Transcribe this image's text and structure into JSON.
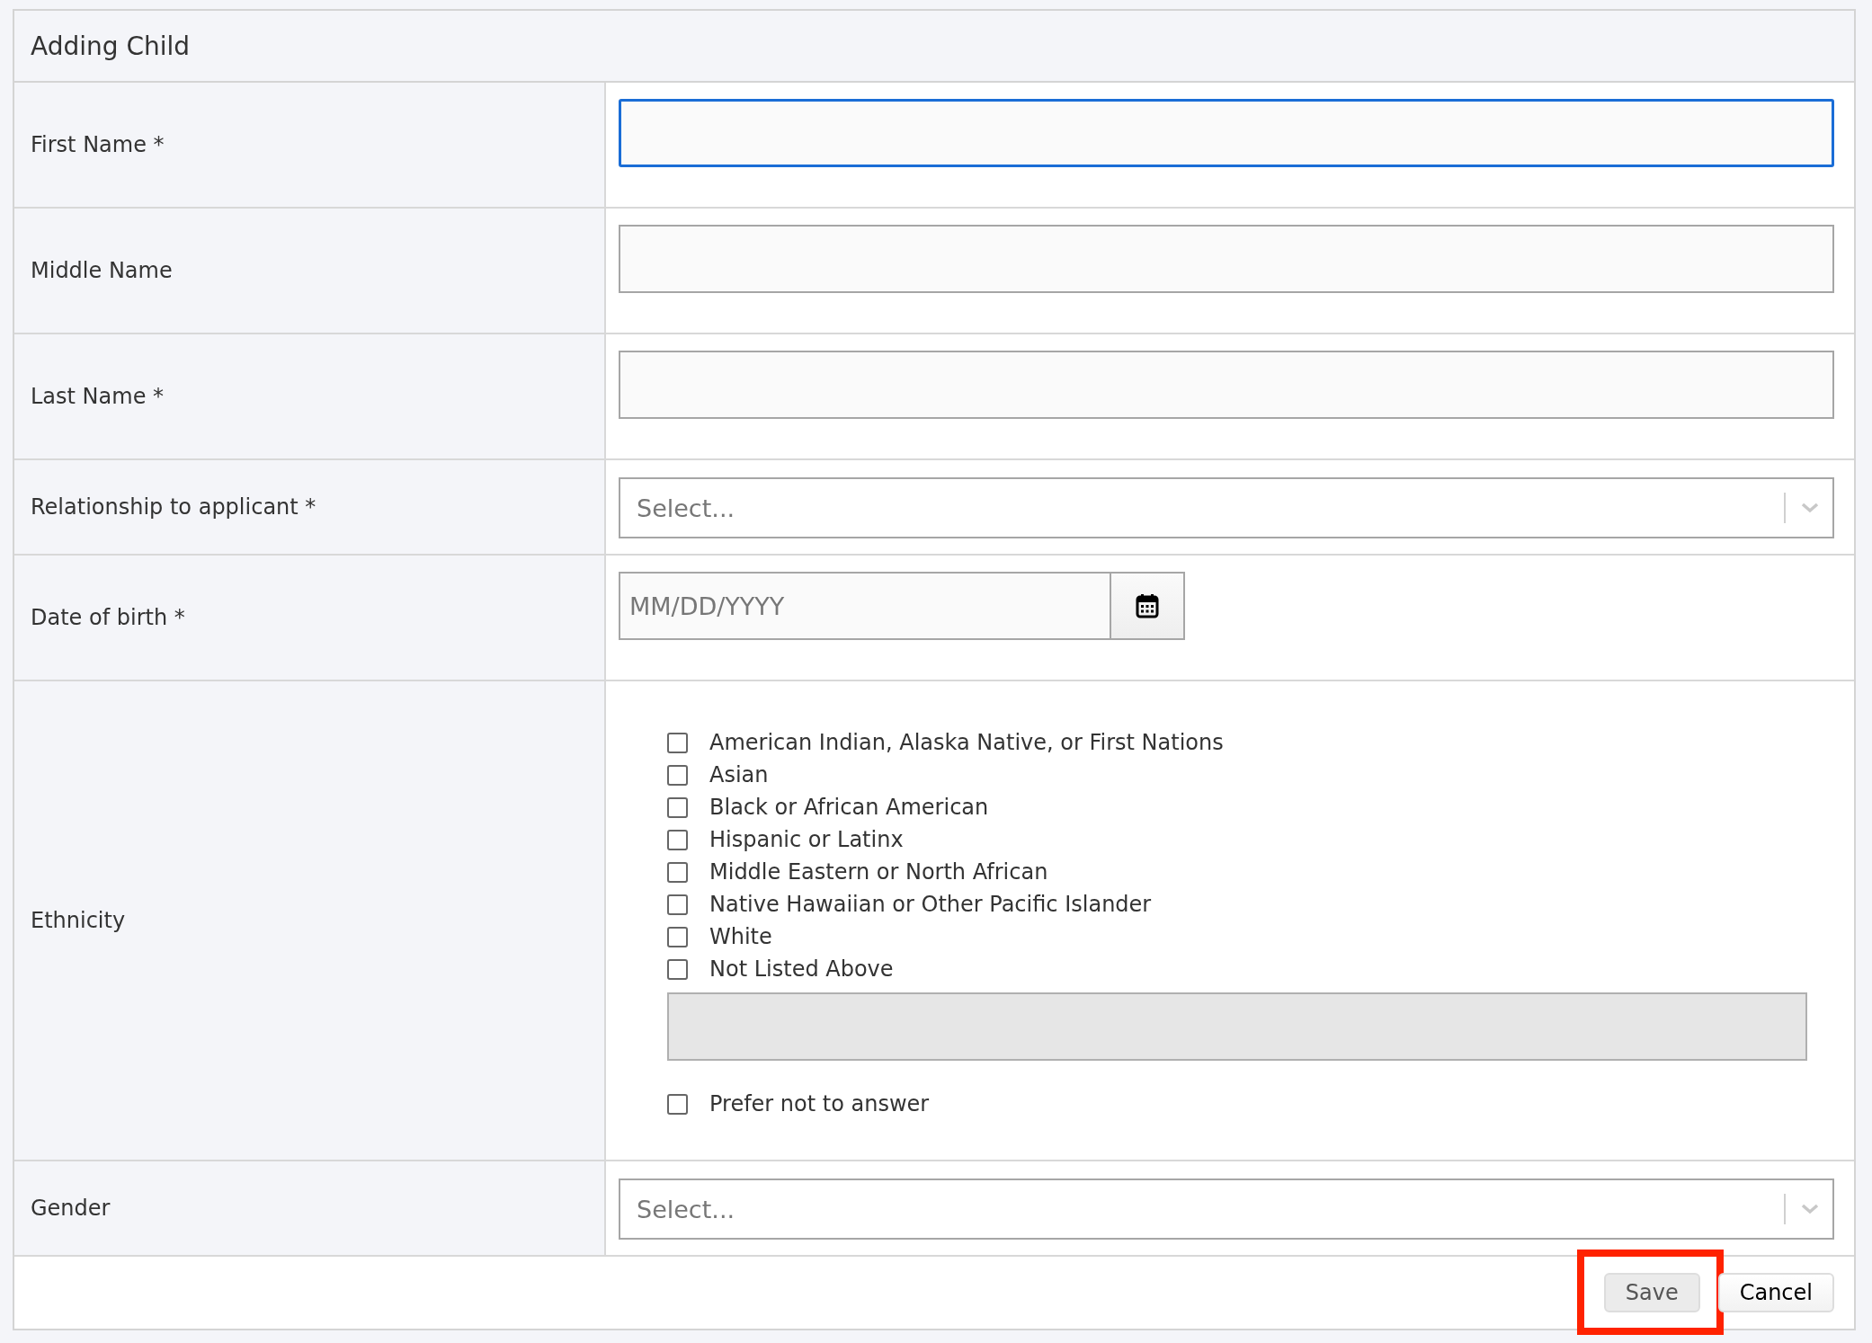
{
  "title": "Adding Child",
  "fields": [
    {
      "kind": "text",
      "label": "First Name *",
      "focused": true
    },
    {
      "kind": "text",
      "label": "Middle Name",
      "focused": false
    },
    {
      "kind": "text",
      "label": "Last Name *",
      "focused": false
    },
    {
      "kind": "select",
      "label": "Relationship to applicant *",
      "placeholder": "Select..."
    },
    {
      "kind": "date",
      "label": "Date of birth *",
      "placeholder": "MM/DD/YYYY"
    },
    {
      "kind": "checkboxes",
      "label": "Ethnicity",
      "options": [
        {
          "label": "American Indian, Alaska Native, or First Nations",
          "checked": false
        },
        {
          "label": "Asian",
          "checked": false
        },
        {
          "label": "Black or African American",
          "checked": false
        },
        {
          "label": "Hispanic or Latinx",
          "checked": false
        },
        {
          "label": "Middle Eastern or North African",
          "checked": false
        },
        {
          "label": "Native Hawaiian or Other Pacific Islander",
          "checked": false
        },
        {
          "label": "White",
          "checked": false
        },
        {
          "label": "Not Listed Above",
          "checked": false
        }
      ],
      "other_field": {
        "disabled": true
      },
      "opt_out": {
        "label": "Prefer not to answer",
        "checked": false
      }
    },
    {
      "kind": "select",
      "label": "Gender",
      "placeholder": "Select..."
    }
  ],
  "buttons": [
    {
      "label": "Save",
      "highlighted": true
    },
    {
      "label": "Cancel",
      "highlighted": false
    }
  ]
}
